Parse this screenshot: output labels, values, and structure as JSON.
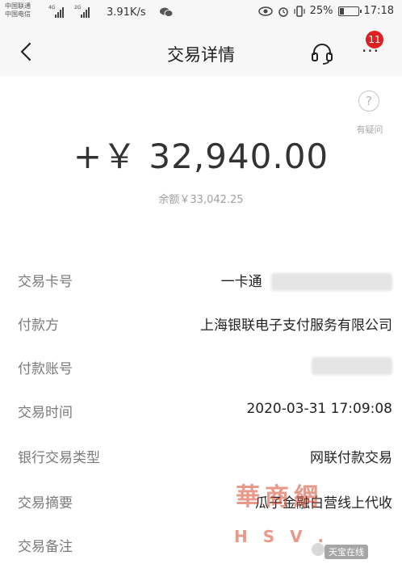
{
  "status_bar": {
    "carrier_1": "中国联通",
    "carrier_2": "中国电信",
    "net_1": "4G",
    "net_2": "2G",
    "speed": "3.91K/s",
    "battery": "25%",
    "battery_level": 0.25,
    "time": "17:18"
  },
  "header": {
    "title": "交易详情",
    "notification_count": "11"
  },
  "help": {
    "label": "有疑问"
  },
  "amount": "+￥ 32,940.00",
  "balance": "余额￥33,042.25",
  "details": {
    "card_no_label": "交易卡号",
    "card_no_value": "一卡通",
    "payer_label": "付款方",
    "payer_value": "上海银联电子支付服务有限公司",
    "payer_account_label": "付款账号",
    "time_label": "交易时间",
    "time_value": "2020-03-31 17:09:08",
    "type_label": "银行交易类型",
    "type_value": "网联付款交易",
    "summary_label": "交易摘要",
    "summary_value": "瓜子金融白营线上代收",
    "remark_label": "交易备注"
  },
  "watermark": {
    "logo": "華商網",
    "url": "H S V .",
    "credit": "天宝在线"
  }
}
